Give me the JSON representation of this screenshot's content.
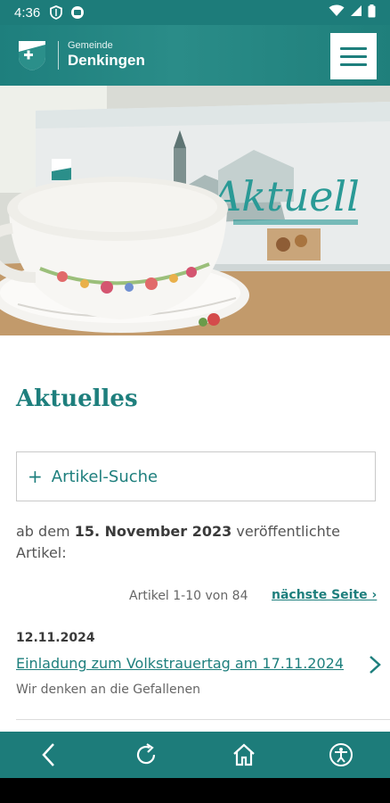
{
  "status_bar": {
    "time": "4:36",
    "icons": [
      "shield-icon",
      "app-icon",
      "wifi-icon",
      "signal-icon",
      "battery-icon"
    ]
  },
  "header": {
    "brand_small": "Gemeinde",
    "brand_big": "Denkingen",
    "menu_icon": "hamburger-icon"
  },
  "hero": {
    "paper_title": "Aktuell"
  },
  "main": {
    "title": "Aktuelles",
    "search_label": "Artikel-Suche",
    "filter_prefix": "ab dem ",
    "filter_date": "15. November 2023",
    "filter_suffix": " veröffentlichte Artikel:",
    "pager_count": "Artikel 1-10 von 84",
    "pager_next": "nächste Seite ›"
  },
  "articles": [
    {
      "date": "12.11.2024",
      "title": "Einladung zum Volkstrauertag am 17.11.2024",
      "subtitle": "Wir denken an die Gefallenen"
    }
  ],
  "bottom_bar": {
    "buttons": [
      "back-icon",
      "reload-icon",
      "home-icon",
      "accessibility-icon"
    ]
  },
  "colors": {
    "accent": "#1e7f7d",
    "statusbar": "#1d7c7a"
  }
}
